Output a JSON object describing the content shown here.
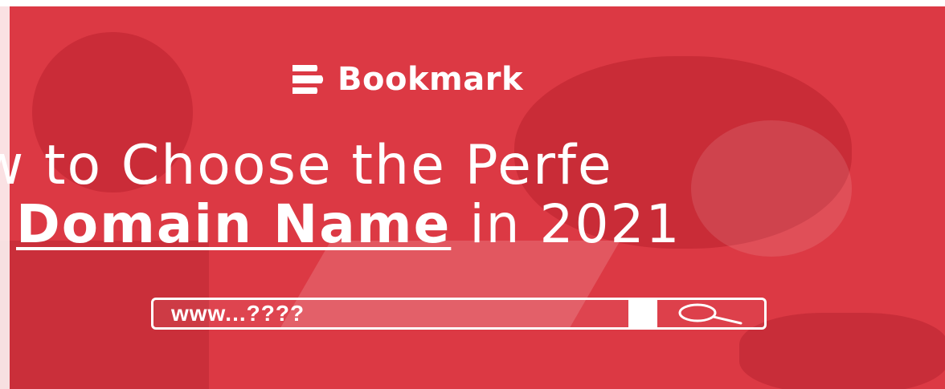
{
  "brand": {
    "name": "Bookmark",
    "icon": "stacked-lines-logo-icon"
  },
  "headline": {
    "line1": "ow to Choose the Perfe",
    "line2_emphasis": "Domain Name",
    "line2_rest": " in 2021"
  },
  "search": {
    "value": "www...????",
    "button_icon": "magnifier-icon"
  },
  "colors": {
    "background": "#dc3944",
    "foreground": "#ffffff"
  }
}
